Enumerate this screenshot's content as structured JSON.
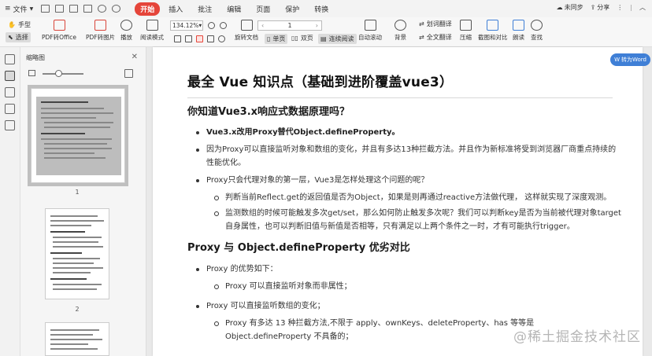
{
  "menubar": {
    "file_label": "文件",
    "tabs": [
      "开始",
      "插入",
      "批注",
      "编辑",
      "页面",
      "保护",
      "转换"
    ],
    "active_tab": "开始",
    "sync_label": "未同步",
    "share_label": "分享"
  },
  "ribbon": {
    "hand_label": "手型",
    "select_label": "选择",
    "pdf_to_office": "PDF转Office",
    "pdf_to_image": "PDF转图片",
    "play": "播放",
    "read_mode": "阅读模式",
    "zoom_value": "134.12%",
    "page_value": "1",
    "rotate_doc": "旋转文档",
    "single_page": "单页",
    "double_page": "双页",
    "continuous": "连续阅读",
    "auto_scroll": "自动滚动",
    "background": "背景",
    "translate_word": "划词翻译",
    "translate_full": "全文翻译",
    "compress": "压缩",
    "screenshot_compare": "截图和对比",
    "read_aloud": "朗读",
    "find": "查找"
  },
  "thumbnails": {
    "title": "缩略图",
    "pages": [
      "1",
      "2"
    ]
  },
  "document": {
    "to_word_button": "转为Word",
    "title": "最全 Vue 知识点（基础到进阶覆盖vue3）",
    "section1": {
      "heading": "你知道Vue3.x响应式数据原理吗？",
      "bullets": [
        "Vue3.x改用Proxy替代Object.defineProperty。",
        "因为Proxy可以直接监听对象和数组的变化，并且有多达13种拦截方法。并且作为新标准将受到浏览器厂商重点持续的性能优化。",
        "Proxy只会代理对象的第一层，Vue3是怎样处理这个问题的呢？"
      ],
      "sub_bullets": [
        "判断当前Reflect.get的返回值是否为Object，如果是则再通过reactive方法做代理， 这样就实现了深度观测。",
        "监测数组的时候可能触发多次get/set，那么如何防止触发多次呢？我们可以判断key是否为当前被代理对象target自身属性，也可以判断旧值与新值是否相等，只有满足以上两个条件之一时，才有可能执行trigger。"
      ]
    },
    "section2": {
      "heading": "Proxy 与 Object.defineProperty 优劣对比",
      "bullet1": "Proxy 的优势如下：",
      "sub1": "Proxy 可以直接监听对象而非属性；",
      "bullet2": "Proxy 可以直接监听数组的变化；",
      "sub2": "Proxy 有多达 13 种拦截方法,不限于 apply、ownKeys、deleteProperty、has 等等是",
      "sub2_cont": "Object.defineProperty 不具备的；"
    }
  },
  "watermark": "@稀土掘金技术社区"
}
